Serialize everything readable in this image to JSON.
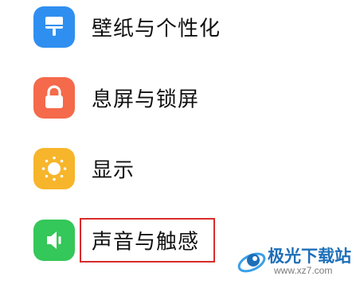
{
  "settings": {
    "items": [
      {
        "label": "壁纸与个性化",
        "icon": "wallpaper-icon",
        "color": "#2f8ff0"
      },
      {
        "label": "息屏与锁屏",
        "icon": "lock-icon",
        "color": "#f46a4b"
      },
      {
        "label": "显示",
        "icon": "brightness-icon",
        "color": "#f7b52b"
      },
      {
        "label": "声音与触感",
        "icon": "speaker-icon",
        "color": "#34c759",
        "highlighted": true
      }
    ]
  },
  "highlight": {
    "color": "#d92b2b"
  },
  "watermark": {
    "title": "极光下载站",
    "url": "www.xz7.com"
  }
}
